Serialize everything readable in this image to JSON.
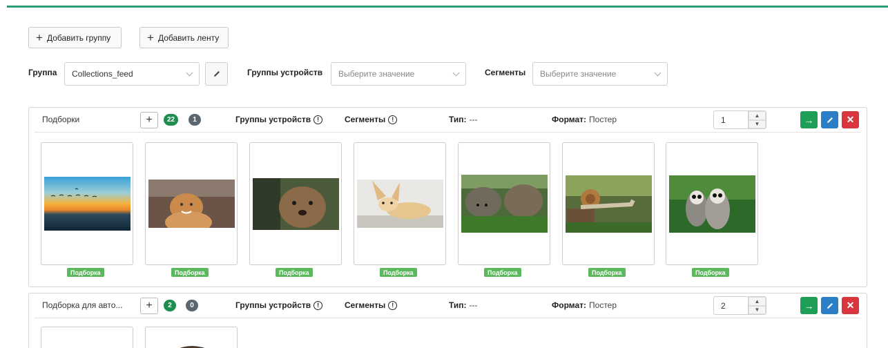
{
  "toolbar": {
    "add_group_label": "Добавить группу",
    "add_feed_label": "Добавить ленту"
  },
  "filters": {
    "group_label": "Группа",
    "group_value": "Collections_feed",
    "device_groups_label": "Группы устройств",
    "device_groups_placeholder": "Выберите значение",
    "segments_label": "Сегменты",
    "segments_placeholder": "Выберите значение"
  },
  "feeds": [
    {
      "title": "Подборки",
      "count_green": "22",
      "count_gray": "1",
      "device_groups_label": "Группы устройств",
      "segments_label": "Сегменты",
      "type_label": "Тип:",
      "type_value": "---",
      "format_label": "Формат:",
      "format_value": "Постер",
      "order": "1",
      "cards": [
        {
          "tag": "Подборка",
          "image": "sunset-birds"
        },
        {
          "tag": "Подборка",
          "image": "cat"
        },
        {
          "tag": "Подборка",
          "image": "quokka"
        },
        {
          "tag": "Подборка",
          "image": "fennec-fox"
        },
        {
          "tag": "Подборка",
          "image": "hedgehogs"
        },
        {
          "tag": "Подборка",
          "image": "snail"
        },
        {
          "tag": "Подборка",
          "image": "lemurs"
        }
      ]
    },
    {
      "title": "Подборка для авто...",
      "count_green": "2",
      "count_gray": "0",
      "device_groups_label": "Группы устройств",
      "segments_label": "Сегменты",
      "type_label": "Тип:",
      "type_value": "---",
      "format_label": "Формат:",
      "format_value": "Постер",
      "order": "2"
    }
  ],
  "icons": {
    "add": "plus-icon",
    "edit": "pencil-icon",
    "info": "info-icon",
    "go": "arrow-right-icon",
    "delete": "close-icon",
    "chevron": "chevron-down-icon"
  },
  "colors": {
    "accent": "#2e9b73",
    "badge_green": "#1e8e4e",
    "badge_gray": "#5b6770",
    "go": "#1e9e56",
    "edit": "#2a7fc6",
    "delete": "#d9363e",
    "tag": "#5cb85c"
  }
}
